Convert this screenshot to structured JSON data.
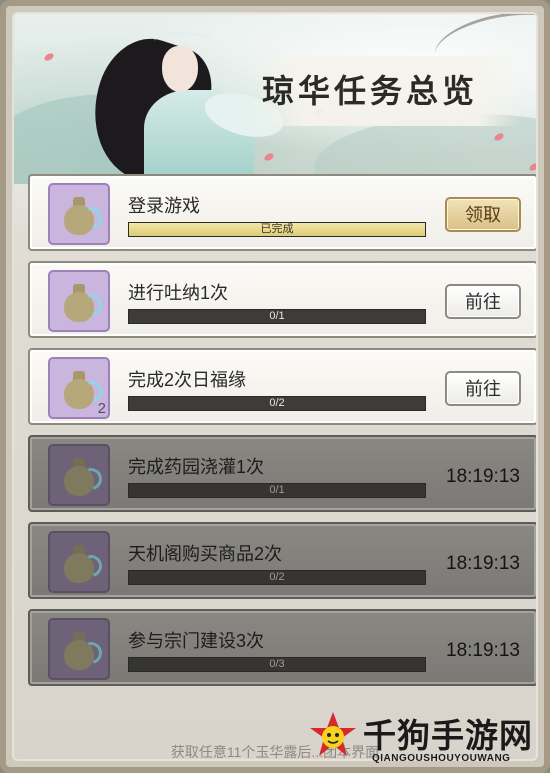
{
  "header": {
    "title": "琼华任务总览"
  },
  "tasks": [
    {
      "name": "登录游戏",
      "progress_text": "已完成",
      "progress": 1.0,
      "state": "completed",
      "action_label": "领取",
      "icon": "jade-vase-icon",
      "icon_count": ""
    },
    {
      "name": "进行吐纳1次",
      "progress_text": "0/1",
      "progress": 0,
      "state": "available",
      "action_label": "前往",
      "icon": "jade-vase-icon",
      "icon_count": ""
    },
    {
      "name": "完成2次日福缘",
      "progress_text": "0/2",
      "progress": 0,
      "state": "available",
      "action_label": "前往",
      "icon": "jade-vase-icon",
      "icon_count": "2"
    },
    {
      "name": "完成药园浇灌1次",
      "progress_text": "0/1",
      "progress": 0,
      "state": "locked",
      "timer": "18:19:13",
      "icon": "jade-vase-icon",
      "icon_count": ""
    },
    {
      "name": "天机阁购买商品2次",
      "progress_text": "0/2",
      "progress": 0,
      "state": "locked",
      "timer": "18:19:13",
      "icon": "jade-vase-icon",
      "icon_count": ""
    },
    {
      "name": "参与宗门建设3次",
      "progress_text": "0/3",
      "progress": 0,
      "state": "locked",
      "timer": "18:19:13",
      "icon": "jade-vase-icon",
      "icon_count": ""
    }
  ],
  "footer": {
    "text": "获取任意11个玉华露后...团本界面"
  },
  "watermark": {
    "title": "千狗手游网",
    "subtitle": "QIANGOUSHOUYOUWANG"
  },
  "colors": {
    "accent_gold": "#d9c088",
    "locked_bg": "#7b7975",
    "icon_bg": "#c9b5dd"
  }
}
